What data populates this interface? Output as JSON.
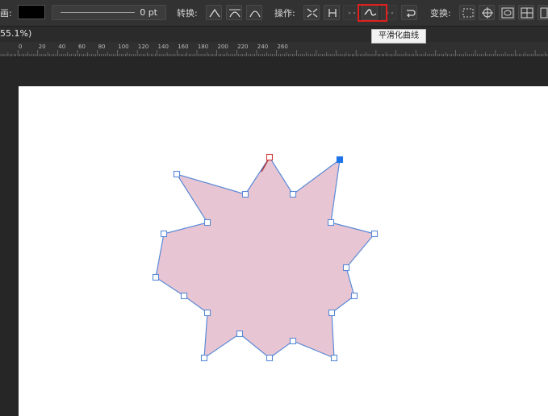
{
  "toolbar": {
    "stroke_label": "画:",
    "stroke_width": "0 pt",
    "convert_label": "转换:",
    "action_label": "操作:",
    "transform_label": "变换:"
  },
  "zoom_text": "55.1%)",
  "tooltip": "平滑化曲线",
  "ruler": {
    "labels": [
      "0",
      "20",
      "40",
      "60",
      "80",
      "100",
      "120",
      "140",
      "160",
      "180",
      "200",
      "220",
      "240",
      "260"
    ]
  },
  "colors": {
    "shape_fill": "#e8c5d2",
    "shape_stroke": "#5a8ad8",
    "highlight": "#e0201d",
    "selected_node": "#1e74e8",
    "start_node": "#d23c3c"
  }
}
